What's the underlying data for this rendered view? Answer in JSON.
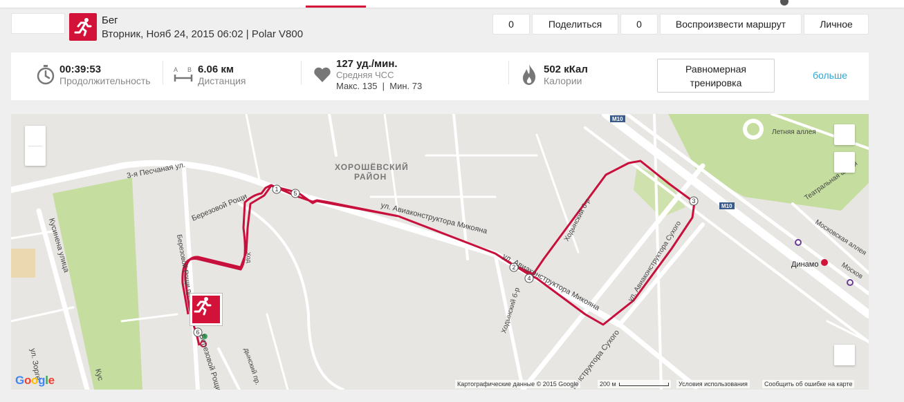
{
  "header": {
    "activity_type": "Бег",
    "activity_meta": "Вторник, Нояб 24, 2015 06:02 | Polar V800",
    "actions": {
      "count1": "0",
      "share_label": "Поделиться",
      "count2": "0",
      "replay_label": "Воспроизвести маршрут",
      "privacy_label": "Личное"
    }
  },
  "stats": {
    "duration": {
      "value": "00:39:53",
      "label": "Продолжительность"
    },
    "distance": {
      "value": "6.06 км",
      "label": "Дистанция",
      "icon_a": "A",
      "icon_b": "B"
    },
    "heart_rate": {
      "value": "127 уд./мин.",
      "label": "Средняя ЧСС",
      "details": "Макс. 135  |  Мин. 73"
    },
    "calories": {
      "value": "502 кКал",
      "label": "Калории"
    },
    "training_type": "Равномерная тренировка",
    "more_label": "больше"
  },
  "map": {
    "district": "ХОРОШЁВСКИЙ",
    "district2": "РАЙОН",
    "streets": {
      "pesch": "3-я Песчаная ул.",
      "mikoyan1": "ул. Авиаконструктора Микояна",
      "mikoyan2": "ул. Авиаконструктора Микояна",
      "berezovoy": "Березовой Рощи",
      "berezovoy_pr": "Березовой Рощи пр.",
      "berezovoy2": "Березовой Рощи",
      "kusinen": "Кусинена улица",
      "khodynsky1": "Ходынский б-р",
      "khodynsky2": "Ходынский б-р",
      "sukhogo1": "ул. Авиаконструктора Сухого",
      "sukhogo2": "конструктора Сухого",
      "letnyaya": "Летняя аллея",
      "teatralnaya": "Театральная аллея",
      "moskovskaya": "Московская аллея",
      "moskovskaya2": "Москов",
      "zorge": "ул. Зорге",
      "dynamo": "Динамо",
      "m10a": "M10",
      "m10b": "M10",
      "khod_pr": "дынский пр.",
      "kus": "Кус",
      "fragment_hod": "Ход"
    },
    "markers": [
      "1",
      "2",
      "3",
      "4",
      "5",
      "6"
    ],
    "attribution": {
      "data": "Картографические данные © 2015 Google",
      "scale": "200 м",
      "terms": "Условия использования",
      "report": "Сообщить об ошибке на карте"
    },
    "google": [
      "G",
      "o",
      "o",
      "g",
      "l",
      "e"
    ]
  },
  "colors": {
    "brand": "#d3123a",
    "route": "#c8103c",
    "link": "#2aa7d8",
    "park": "#c5dea0"
  },
  "icons": {
    "sport": "running-icon",
    "duration": "stopwatch-icon",
    "distance": "distance-ab-icon",
    "heart": "heart-icon",
    "calories": "flame-icon"
  }
}
